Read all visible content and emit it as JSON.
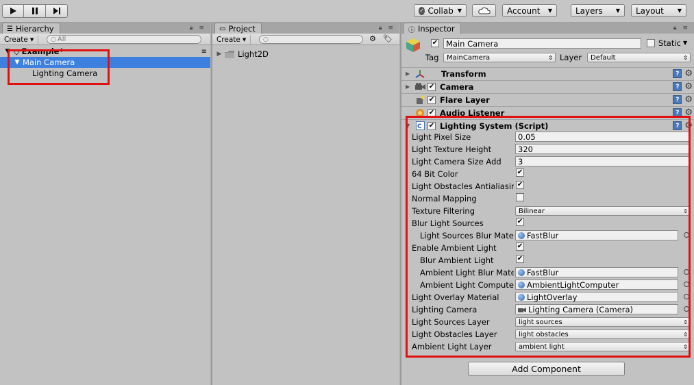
{
  "toolbar": {
    "collab_label": "Collab",
    "account_label": "Account",
    "layers_label": "Layers",
    "layout_label": "Layout"
  },
  "hierarchy": {
    "tab_label": "Hierarchy",
    "create_label": "Create",
    "search_placeholder": "All",
    "scene_name": "Example*",
    "items": [
      {
        "label": "Main Camera",
        "selected": true
      },
      {
        "label": "Lighting Camera",
        "selected": false
      }
    ]
  },
  "project": {
    "tab_label": "Project",
    "create_label": "Create",
    "folders": [
      {
        "label": "Light2D"
      }
    ]
  },
  "inspector": {
    "tab_label": "Inspector",
    "object_name": "Main Camera",
    "object_active": true,
    "static_label": "Static",
    "tag_label": "Tag",
    "tag_value": "MainCamera",
    "layer_label": "Layer",
    "layer_value": "Default",
    "components": [
      {
        "name": "Transform",
        "has_checkbox": false,
        "icon": "transform-icon"
      },
      {
        "name": "Camera",
        "has_checkbox": true,
        "icon": "camera-icon"
      },
      {
        "name": "Flare Layer",
        "has_checkbox": true,
        "icon": "flare-layer-icon"
      },
      {
        "name": "Audio Listener",
        "has_checkbox": true,
        "icon": "audio-listener-icon"
      },
      {
        "name": "Lighting System (Script)",
        "has_checkbox": true,
        "icon": "script-icon"
      }
    ],
    "lighting_props": [
      {
        "label": "Light Pixel Size",
        "kind": "text",
        "value": "0.05",
        "indent": 0
      },
      {
        "label": "Light Texture Height",
        "kind": "text",
        "value": "320",
        "indent": 0
      },
      {
        "label": "Light Camera Size Add",
        "kind": "text",
        "value": "3",
        "indent": 0
      },
      {
        "label": "64 Bit Color",
        "kind": "check",
        "value": true,
        "indent": 0
      },
      {
        "label": "Light Obstacles Antialiasing",
        "kind": "check",
        "value": true,
        "indent": 0
      },
      {
        "label": "Normal Mapping",
        "kind": "check",
        "value": false,
        "indent": 0
      },
      {
        "label": "Texture Filtering",
        "kind": "dropdown",
        "value": "Bilinear",
        "indent": 0
      },
      {
        "label": "Blur Light Sources",
        "kind": "check",
        "value": true,
        "indent": 0
      },
      {
        "label": "Light Sources Blur Material",
        "kind": "object",
        "value": "FastBlur",
        "indent": 1,
        "icon": "material-icon"
      },
      {
        "label": "Enable Ambient Light",
        "kind": "check",
        "value": true,
        "indent": 0
      },
      {
        "label": "Blur Ambient Light",
        "kind": "check",
        "value": true,
        "indent": 1
      },
      {
        "label": "Ambient Light Blur Material",
        "kind": "object",
        "value": "FastBlur",
        "indent": 1,
        "icon": "material-icon"
      },
      {
        "label": "Ambient Light Compute Material",
        "kind": "object",
        "value": "AmbientLightComputer",
        "indent": 1,
        "icon": "material-icon"
      },
      {
        "label": "Light Overlay Material",
        "kind": "object",
        "value": "LightOverlay",
        "indent": 0,
        "icon": "material-icon"
      },
      {
        "label": "Lighting Camera",
        "kind": "object",
        "value": "Lighting Camera (Camera)",
        "indent": 0,
        "icon": "camera-icon"
      },
      {
        "label": "Light Sources Layer",
        "kind": "dropdown",
        "value": "light sources",
        "indent": 0
      },
      {
        "label": "Light Obstacles Layer",
        "kind": "dropdown",
        "value": "light obstacles",
        "indent": 0
      },
      {
        "label": "Ambient Light Layer",
        "kind": "dropdown",
        "value": "ambient light",
        "indent": 0
      }
    ],
    "add_component_label": "Add Component"
  },
  "colors": {
    "selection": "#3d80df",
    "highlight_box": "#e01010"
  }
}
